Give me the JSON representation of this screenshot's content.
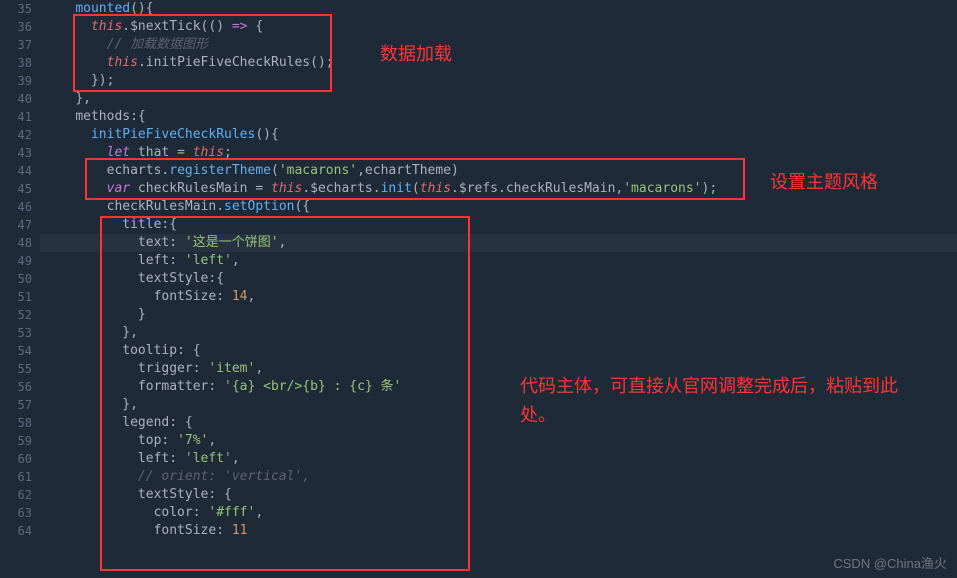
{
  "gutter": [
    "35",
    "36",
    "37",
    "38",
    "39",
    "40",
    "41",
    "42",
    "43",
    "44",
    "45",
    "46",
    "47",
    "48",
    "49",
    "50",
    "51",
    "52",
    "53",
    "54",
    "55",
    "56",
    "57",
    "58",
    "59",
    "60",
    "61",
    "62",
    "63",
    "64"
  ],
  "code": {
    "l35": {
      "a": "mounted",
      "b": "(){"
    },
    "l36": {
      "a": "this",
      "b": ".$nextTick(() ",
      "c": "=>",
      "d": " {"
    },
    "l37": {
      "a": "// 加载数据图形"
    },
    "l38": {
      "a": "this",
      "b": ".initPieFiveCheckRules();"
    },
    "l39": {
      "a": "});"
    },
    "l40": {
      "a": "},"
    },
    "l41": {
      "a": "methods:{"
    },
    "l42": {
      "a": "initPieFiveCheckRules",
      "b": "(){"
    },
    "l43": {
      "a": "let",
      "b": " that = ",
      "c": "this",
      "d": ";"
    },
    "l44": {
      "a": "echarts.",
      "b": "registerTheme",
      "c": "(",
      "d": "'macarons'",
      "e": ",echartTheme)"
    },
    "l45": {
      "a": "var",
      "b": " checkRulesMain = ",
      "c": "this",
      "d": ".$echarts.",
      "e": "init",
      "f": "(",
      "g": "this",
      "h": ".$refs.checkRulesMain,",
      "i": "'macarons'",
      "j": ");"
    },
    "l46": {
      "a": "checkRulesMain.",
      "b": "setOption",
      "c": "({"
    },
    "l47": {
      "a": "title:{"
    },
    "l48": {
      "a": "text: ",
      "b": "'这是一个饼图'",
      "c": ","
    },
    "l49": {
      "a": "left: ",
      "b": "'left'",
      "c": ","
    },
    "l50": {
      "a": "textStyle:{"
    },
    "l51": {
      "a": "fontSize: ",
      "b": "14",
      "c": ","
    },
    "l52": {
      "a": "}"
    },
    "l53": {
      "a": "},"
    },
    "l54": {
      "a": "tooltip: {"
    },
    "l55": {
      "a": "trigger: ",
      "b": "'item'",
      "c": ","
    },
    "l56": {
      "a": "formatter: ",
      "b": "'{a} <br/>{b} : {c} 条'"
    },
    "l57": {
      "a": "},"
    },
    "l58": {
      "a": "legend: {"
    },
    "l59": {
      "a": "top: ",
      "b": "'7%'",
      "c": ","
    },
    "l60": {
      "a": "left: ",
      "b": "'left'",
      "c": ","
    },
    "l61": {
      "a": "// orient: 'vertical',"
    },
    "l62": {
      "a": "textStyle: {"
    },
    "l63": {
      "a": "color: ",
      "b": "'#fff'",
      "c": ","
    },
    "l64": {
      "a": "fontSize: ",
      "b": "11"
    }
  },
  "annotations": {
    "label1": "数据加载",
    "label2": "设置主题风格",
    "label3": "代码主体，可直接从官网调整完成后，粘贴到此处。"
  },
  "watermark": "CSDN @China渔火"
}
